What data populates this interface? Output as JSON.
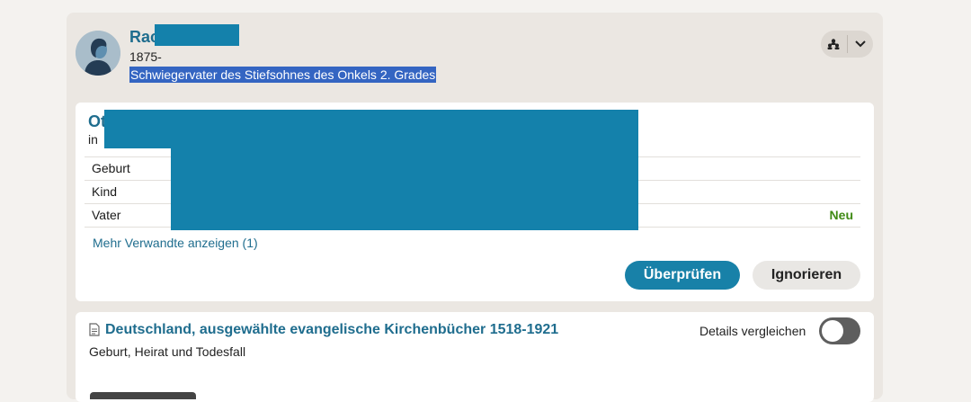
{
  "person": {
    "name": "Rac",
    "years": "1875-",
    "relationship": "Schwiegervater des Stiefsohnes des Onkels 2. Grades"
  },
  "tree_toggle": {
    "icons": [
      "family-tree-icon",
      "chevron-down-icon"
    ]
  },
  "match": {
    "name": "Ot",
    "place": "in",
    "rows": [
      {
        "label": "Geburt",
        "badge": ""
      },
      {
        "label": "Kind",
        "badge": ""
      },
      {
        "label": "Vater",
        "badge": "Neu"
      }
    ],
    "more_link": "Mehr Verwandte anzeigen (1)",
    "review_label": "Überprüfen",
    "ignore_label": "Ignorieren"
  },
  "record": {
    "title": "Deutschland, ausgewählte evangelische Kirchenbücher 1518-1921",
    "events": "Geburt, Heirat und Todesfall",
    "compare_label": "Details vergleichen",
    "compare_enabled": false
  },
  "colors": {
    "accent": "#1f6d8e",
    "button": "#1881a8",
    "new_badge": "#3f8a14",
    "redaction": "#1481ab",
    "selection": "#3465c2"
  }
}
